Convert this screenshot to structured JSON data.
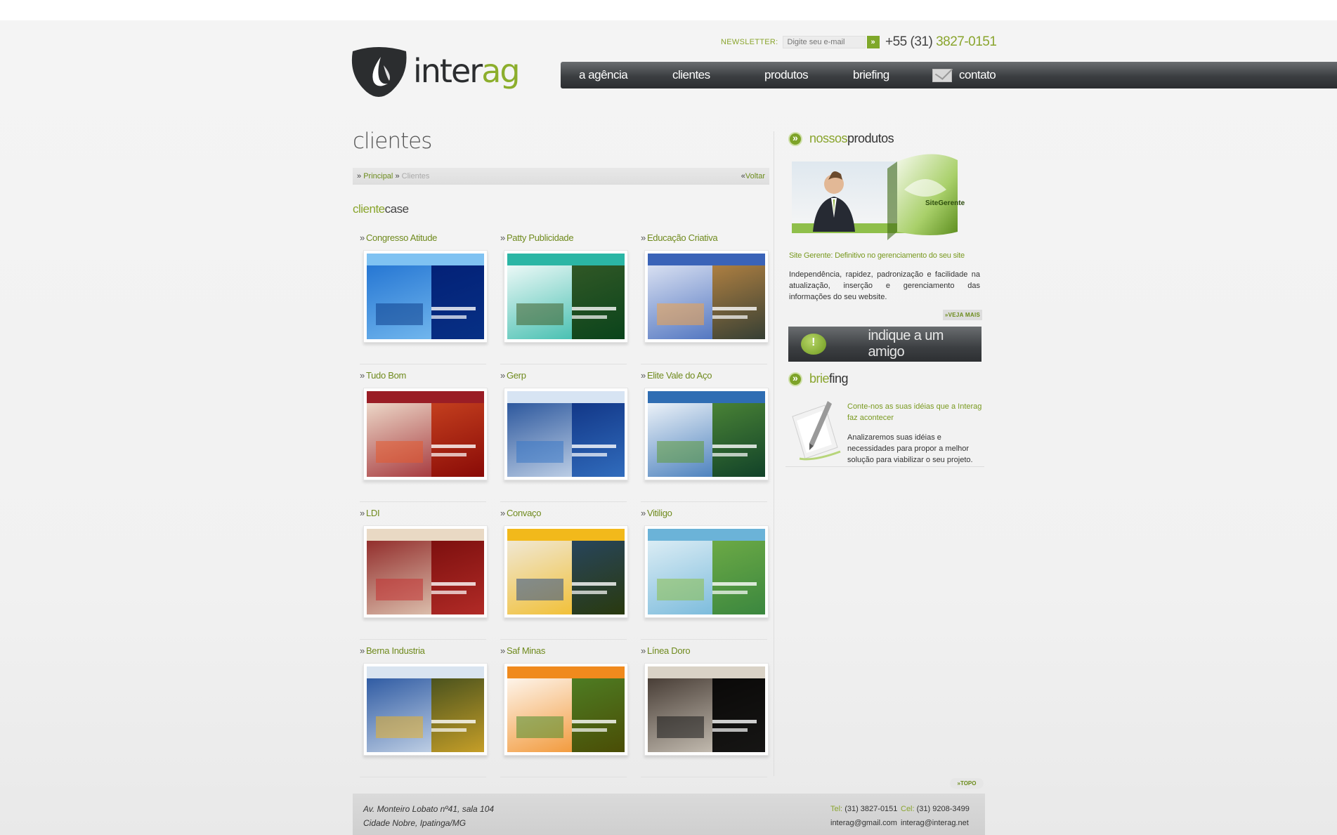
{
  "brand": {
    "logo_dark": "inter",
    "logo_green": "ag"
  },
  "newsletter": {
    "label": "NEWSLETTER:",
    "placeholder": "Digite seu e-mail",
    "go": "»"
  },
  "phone": {
    "prefix": "+55 (31) ",
    "number": "3827-0151"
  },
  "nav": [
    "a agência",
    "clientes",
    "produtos",
    "briefing",
    "contato"
  ],
  "page": {
    "title": "clientes"
  },
  "breadcrumb": {
    "home": "Principal",
    "current": "Clientes",
    "back": "Voltar",
    "sep": "»",
    "back_sep": "«"
  },
  "section": {
    "green": "cliente",
    "dark": "case"
  },
  "cases": [
    {
      "name": "Congresso Atitude",
      "palette": [
        "#1d6fd0",
        "#7fc2f2",
        "#0e3f8c"
      ]
    },
    {
      "name": "Patty Publicidade",
      "palette": [
        "#ffffff",
        "#2bb6a5",
        "#3f5f2a"
      ]
    },
    {
      "name": "Educação Criativa",
      "palette": [
        "#e8ecf7",
        "#3a63b8",
        "#f0a348"
      ]
    },
    {
      "name": "Tudo Bom",
      "palette": [
        "#f4ead8",
        "#9a1d25",
        "#e35a2e"
      ]
    },
    {
      "name": "Gerp",
      "palette": [
        "#1c4a95",
        "#d7e4f3",
        "#3a79c6"
      ]
    },
    {
      "name": "Elite Vale do Aço",
      "palette": [
        "#ffffff",
        "#2f6db3",
        "#5e9a3a"
      ]
    },
    {
      "name": "LDI",
      "palette": [
        "#8a1d1d",
        "#e9d9c4",
        "#c23232"
      ]
    },
    {
      "name": "Convaço",
      "palette": [
        "#efece6",
        "#f2b91b",
        "#2b4f86"
      ]
    },
    {
      "name": "Vitiligo",
      "palette": [
        "#e6f2f7",
        "#6bb3d8",
        "#8cc04a"
      ]
    },
    {
      "name": "Berna Industria",
      "palette": [
        "#1f4e9c",
        "#d9e4f0",
        "#e8b12a"
      ]
    },
    {
      "name": "Saf Minas",
      "palette": [
        "#ffffff",
        "#f08a1d",
        "#4f8e2e"
      ]
    },
    {
      "name": "Línea Doro",
      "palette": [
        "#3a2f28",
        "#d9d2c6",
        "#1a1a1a"
      ]
    }
  ],
  "products": {
    "title_green": "nossos",
    "title_dark": "produtos",
    "box_label": "SiteGerente",
    "caption": "Site Gerente: Definitivo no gerenciamento do seu site",
    "text": "Independência, rapidez, padronização e facilidade na atualização, inserção e gerenciamento das informações do seu website.",
    "more": "»VEJA MAIS"
  },
  "indique": {
    "label": "indique a um amigo"
  },
  "briefing": {
    "title_green": "brie",
    "title_dark": "fing",
    "lead": "Conte-nos as suas idéias que a Interag faz acontecer",
    "text": "Analizaremos suas idéias e necessidades para propor a melhor solução para viabilizar o seu projeto."
  },
  "topo": "»TOPO",
  "footer": {
    "address_1": "Av. Monteiro Lobato nº41, sala 104",
    "address_2": "Cidade Nobre, Ipatinga/MG",
    "tel_label": "Tel:",
    "tel": "(31) 3827-0151",
    "cel_label": "Cel:",
    "cel": "(31) 9208-3499",
    "email_1": "interag@gmail.com",
    "email_2": "interag@interag.net"
  },
  "colors": {
    "accent": "#8aa52e",
    "nav_dark": "#3b3e41"
  }
}
